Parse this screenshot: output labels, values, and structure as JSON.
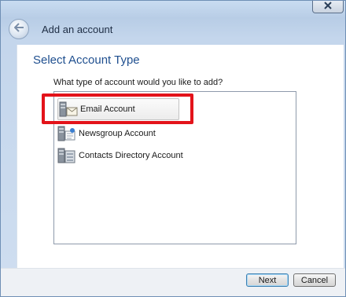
{
  "window": {
    "header_title": "Add an account"
  },
  "page": {
    "section_title": "Select Account Type",
    "prompt": "What type of account would you like to add?"
  },
  "account_types": [
    {
      "label": "Email Account",
      "icon": "email-account-icon",
      "selected": true
    },
    {
      "label": "Newsgroup Account",
      "icon": "newsgroup-account-icon",
      "selected": false
    },
    {
      "label": "Contacts Directory Account",
      "icon": "contacts-directory-icon",
      "selected": false
    }
  ],
  "annotation": {
    "highlight_color": "#e3131a"
  },
  "buttons": {
    "next": "Next",
    "cancel": "Cancel"
  },
  "colors": {
    "title_blue": "#1f4f8f",
    "frame": "#c4d6ec"
  }
}
